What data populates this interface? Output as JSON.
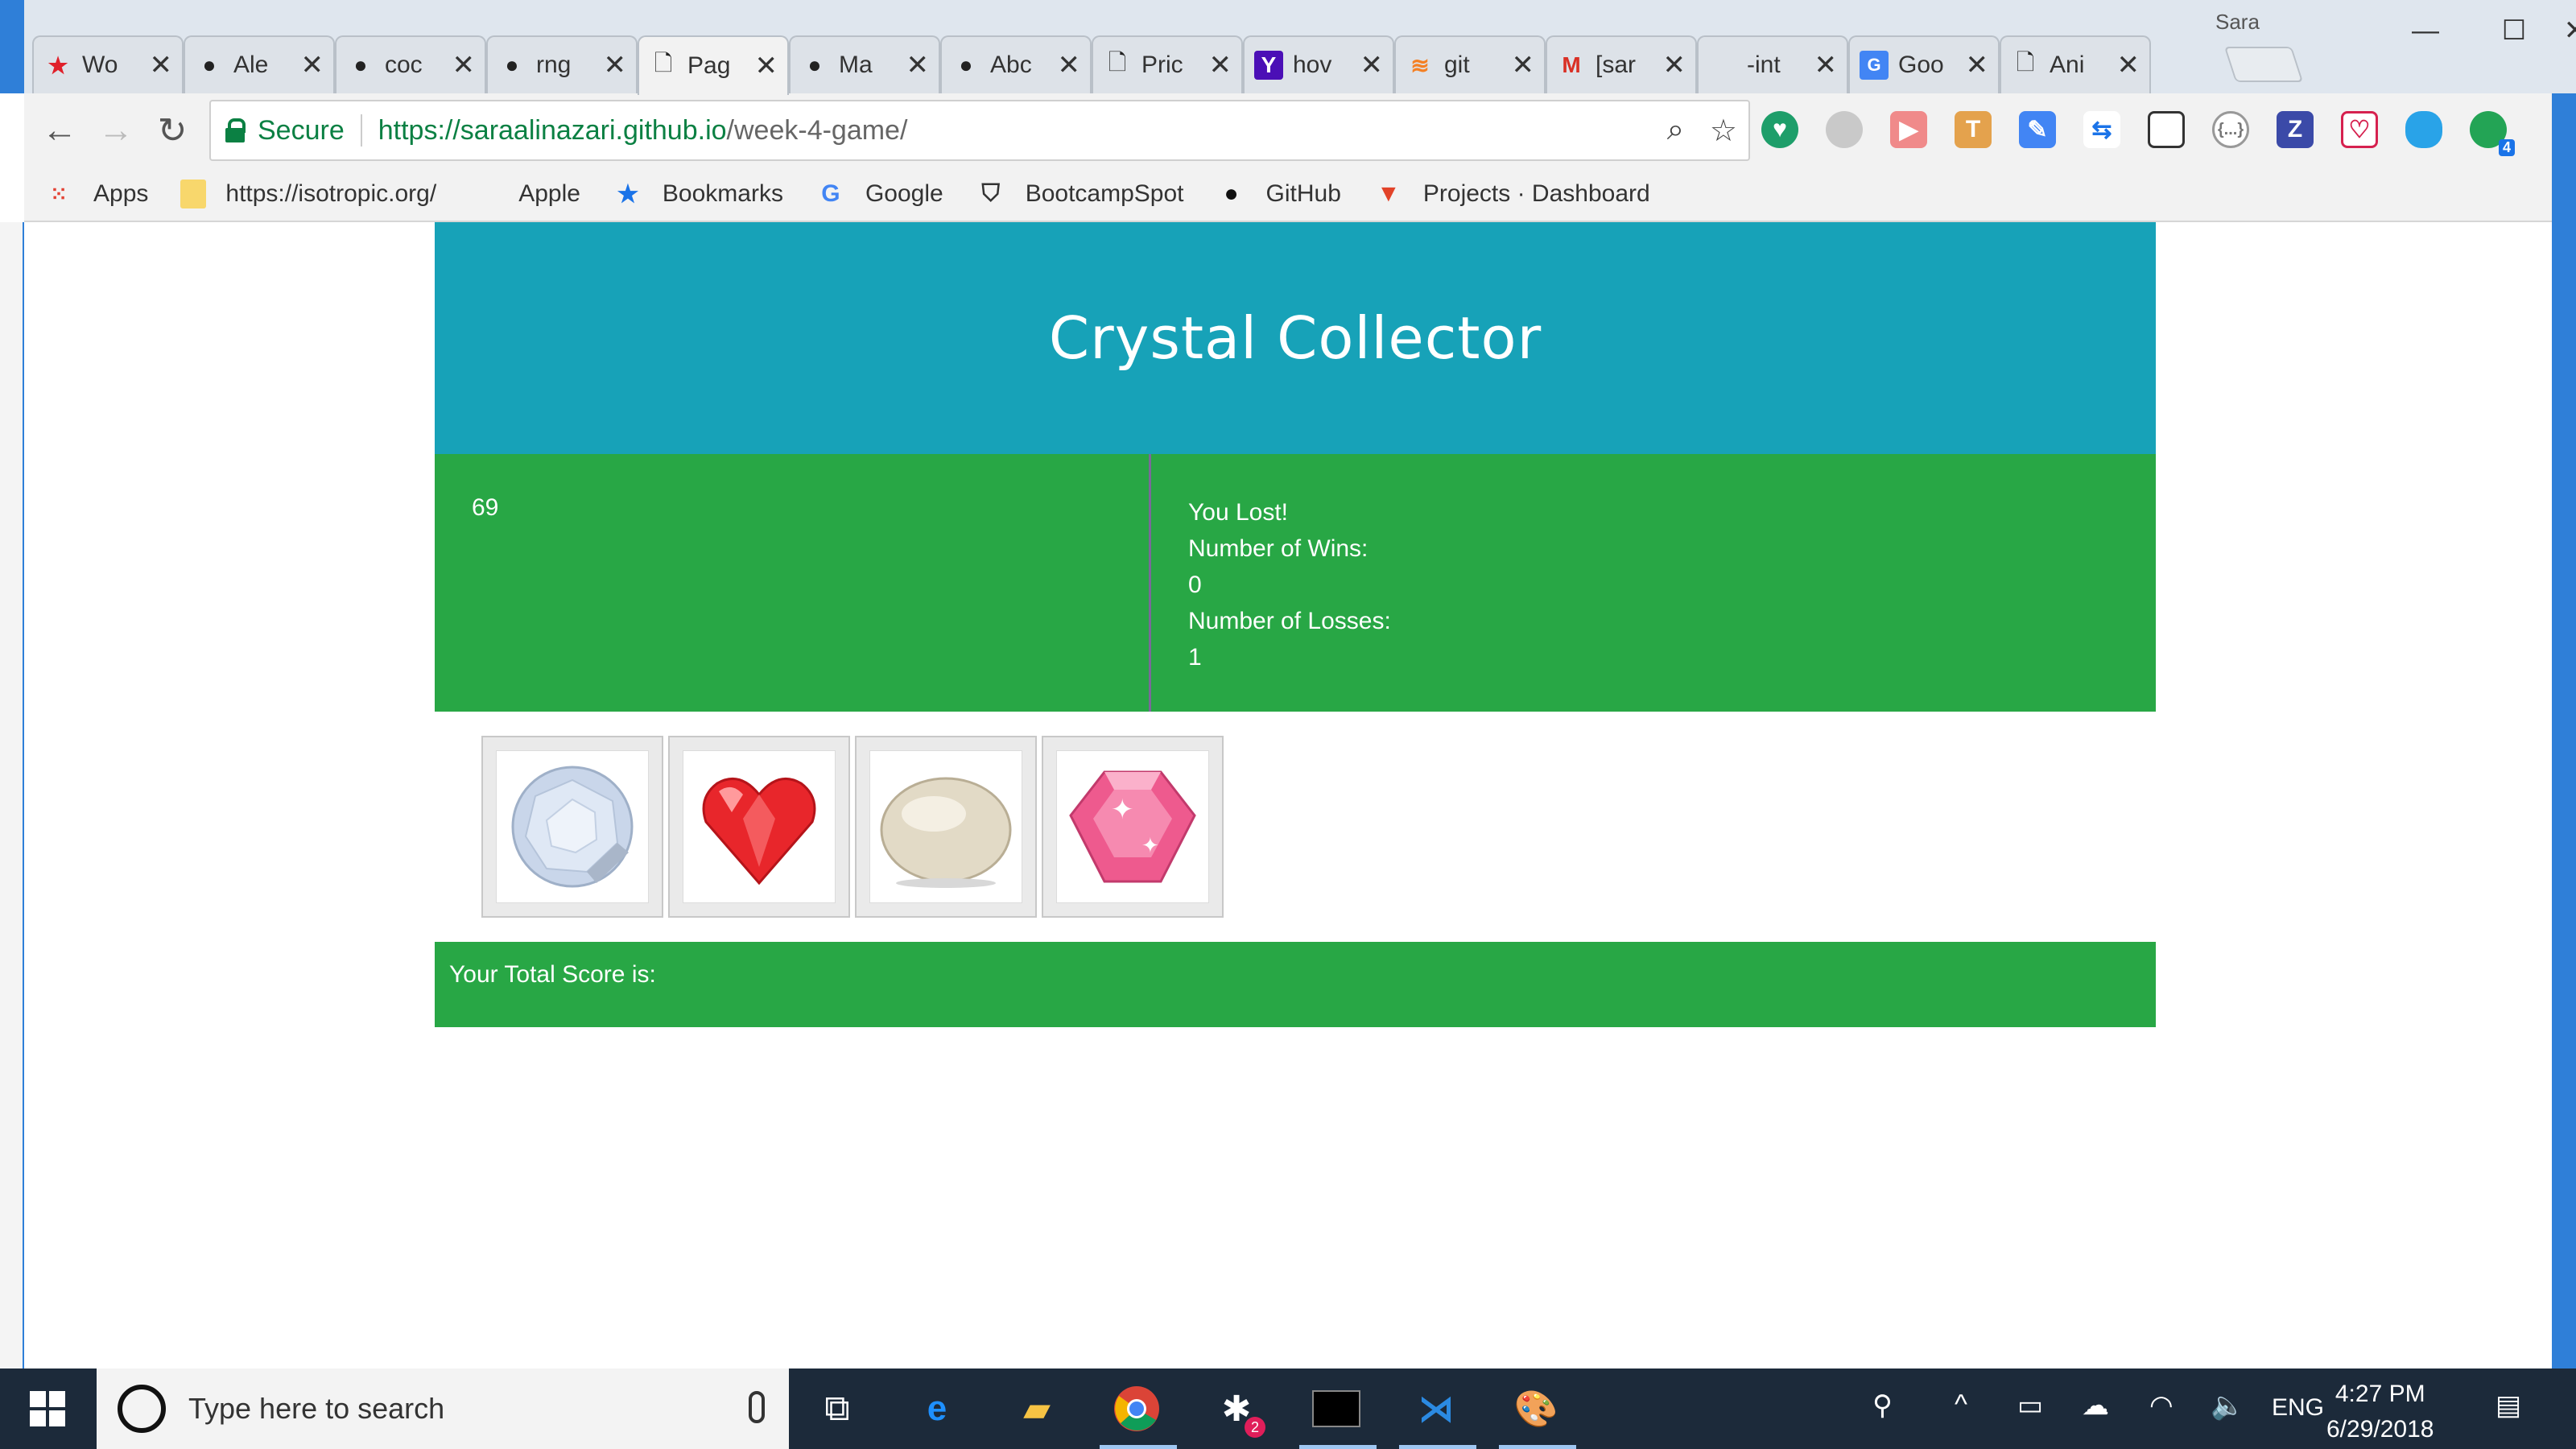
{
  "browser": {
    "profile_name": "Sara",
    "tabs": [
      {
        "title": "Wo",
        "icon": "star-icon",
        "active": false
      },
      {
        "title": "Ale",
        "icon": "github-icon",
        "active": false
      },
      {
        "title": "coc",
        "icon": "github-icon",
        "active": false
      },
      {
        "title": "rng",
        "icon": "github-icon",
        "active": false
      },
      {
        "title": "Pag",
        "icon": "page-icon",
        "active": true
      },
      {
        "title": "Ma",
        "icon": "github-icon",
        "active": false
      },
      {
        "title": "Abc",
        "icon": "github-icon",
        "active": false
      },
      {
        "title": "Pric",
        "icon": "page-icon",
        "active": false
      },
      {
        "title": "hov",
        "icon": "yahoo-icon",
        "active": false
      },
      {
        "title": "git",
        "icon": "stackoverflow-icon",
        "active": false
      },
      {
        "title": "[sar",
        "icon": "gmail-icon",
        "active": false
      },
      {
        "title": "-int",
        "icon": "",
        "active": false
      },
      {
        "title": "Goo",
        "icon": "google-translate-icon",
        "active": false
      },
      {
        "title": "Ani",
        "icon": "page-icon",
        "active": false
      }
    ],
    "secure_label": "Secure",
    "url_host": "https://saraalinazari.github.io",
    "url_path": "/week-4-game/",
    "extension_badge": "4",
    "bookmarks": [
      {
        "label": "Apps",
        "icon": "apps-grid-icon"
      },
      {
        "label": "https://isotropic.org/",
        "icon": "folder-icon"
      },
      {
        "label": "Apple",
        "icon": "apple-icon"
      },
      {
        "label": "Bookmarks",
        "icon": "star-icon"
      },
      {
        "label": "Google",
        "icon": "google-icon"
      },
      {
        "label": "BootcampSpot",
        "icon": "shield-icon"
      },
      {
        "label": "GitHub",
        "icon": "github-icon"
      },
      {
        "label": "Projects · Dashboard",
        "icon": "gitlab-icon"
      }
    ]
  },
  "game": {
    "title": "Crystal Collector",
    "target_number": "69",
    "status": "You Lost!",
    "wins_label": "Number of Wins:",
    "wins": "0",
    "losses_label": "Number of Losses:",
    "losses": "1",
    "crystals": [
      {
        "name": "clear-crystal",
        "color": "#c9d6ea"
      },
      {
        "name": "heart-crystal",
        "color": "#e8262b"
      },
      {
        "name": "pearl-crystal",
        "color": "#e2dac6"
      },
      {
        "name": "pink-crystal",
        "color": "#ee5a8e"
      }
    ],
    "total_score_label": "Your Total Score is:",
    "total_score": ""
  },
  "taskbar": {
    "search_placeholder": "Type here to search",
    "language": "ENG",
    "time": "4:27 PM",
    "date": "6/29/2018",
    "notification_badge": "2"
  },
  "colors": {
    "header_teal": "#17a2b8",
    "panel_green": "#28a745",
    "secure_green": "#0b8043"
  }
}
